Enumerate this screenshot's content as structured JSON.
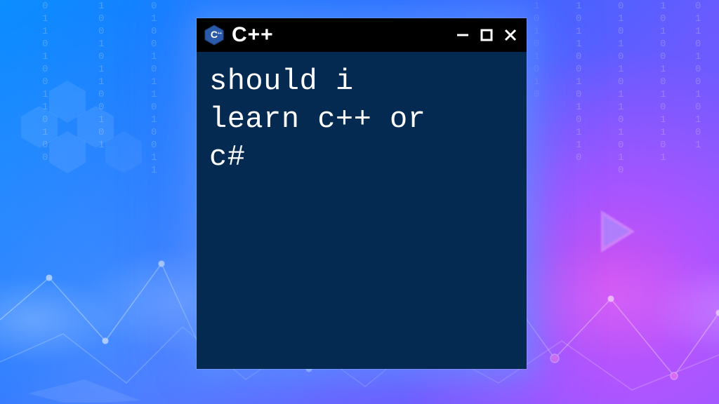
{
  "window": {
    "title": "C++",
    "icon_name": "cpp-logo"
  },
  "terminal": {
    "text": "should i\nlearn c++ or\nc#"
  },
  "colors": {
    "terminal_bg": "#042a52",
    "terminal_fg": "#ffffff",
    "titlebar_bg": "#000000"
  }
}
